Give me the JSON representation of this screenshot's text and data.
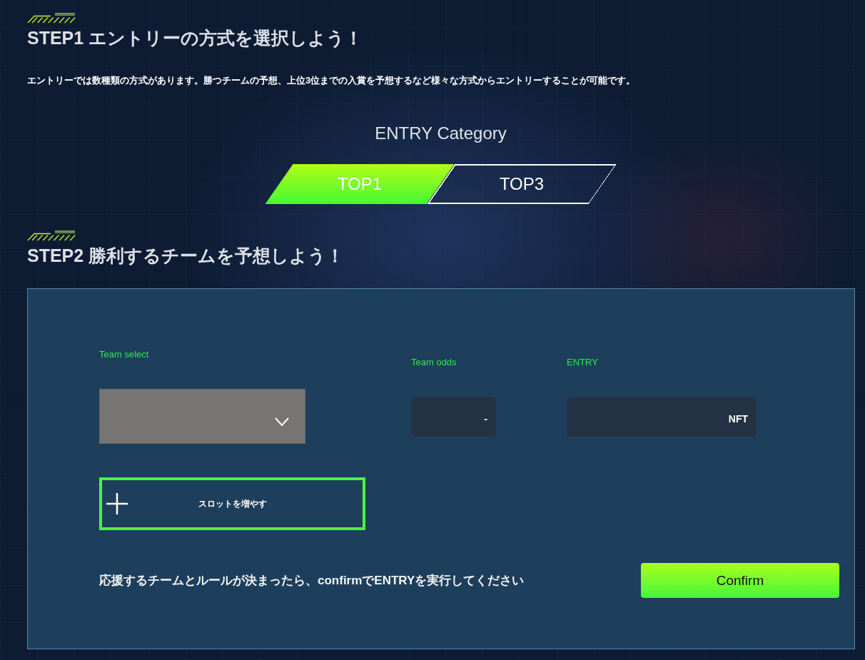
{
  "step1": {
    "heading": "STEP1 エントリーの方式を選択しよう！",
    "description": "エントリーでは数種類の方式があります。勝つチームの予想、上位3位までの入賞を予想するなど様々な方式からエントリーすることが可能です。"
  },
  "entry_category": {
    "title": "ENTRY Category",
    "tabs": [
      {
        "label": "TOP1",
        "selected": true
      },
      {
        "label": "TOP3",
        "selected": false
      }
    ]
  },
  "step2": {
    "heading": "STEP2 勝利するチームを予想しよう！",
    "panel": {
      "fields": [
        {
          "kind": "select",
          "label": "Team select"
        },
        {
          "kind": "readout",
          "label": "Team odds",
          "value": "-"
        },
        {
          "kind": "readout",
          "label": "ENTRY",
          "value": "NFT"
        }
      ],
      "add_slot_button": "スロットを増やす",
      "instruction": "応援するチームとルールが決まったら、confirmでENTRYを実行してください",
      "confirm_button": "Confirm"
    }
  }
}
